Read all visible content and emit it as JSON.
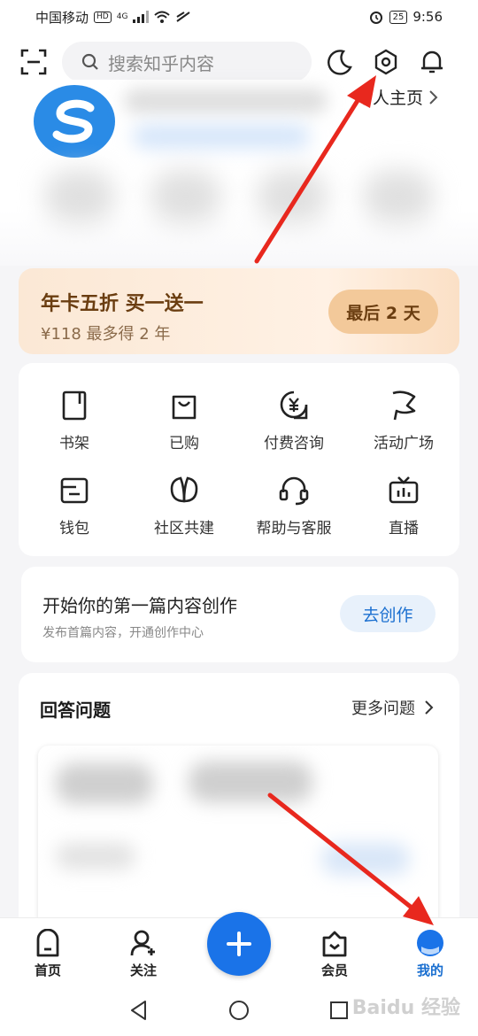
{
  "status_bar": {
    "carrier": "中国移动",
    "hd": "HD",
    "net": "4G",
    "battery": "25",
    "time": "9:56"
  },
  "search": {
    "placeholder": "搜索知乎内容"
  },
  "profile": {
    "homepage_link": "个人主页"
  },
  "promo": {
    "title": "年卡五折 买一送一",
    "subtitle": "¥118 最多得 2 年",
    "button": "最后 2 天"
  },
  "grid": [
    {
      "label": "书架",
      "icon": "book-icon"
    },
    {
      "label": "已购",
      "icon": "bag-icon"
    },
    {
      "label": "付费咨询",
      "icon": "yen-chat-icon"
    },
    {
      "label": "活动广场",
      "icon": "flag-icon"
    },
    {
      "label": "钱包",
      "icon": "wallet-icon"
    },
    {
      "label": "社区共建",
      "icon": "leaf-icon"
    },
    {
      "label": "帮助与客服",
      "icon": "headset-icon"
    },
    {
      "label": "直播",
      "icon": "tv-icon"
    }
  ],
  "create": {
    "title": "开始你的第一篇内容创作",
    "subtitle": "发布首篇内容，开通创作中心",
    "button": "去创作"
  },
  "answer": {
    "title": "回答问题",
    "more": "更多问题"
  },
  "tabs": [
    {
      "label": "首页",
      "icon": "home-icon"
    },
    {
      "label": "关注",
      "icon": "follow-icon"
    },
    {
      "label": "会员",
      "icon": "vip-icon"
    },
    {
      "label": "我的",
      "icon": "profile-icon"
    }
  ],
  "fab_icon": "plus-icon",
  "watermark": "Baidu 经验",
  "colors": {
    "brand": "#1a73e8",
    "promo_text": "#6a3d10",
    "arrow": "#e8281e"
  }
}
